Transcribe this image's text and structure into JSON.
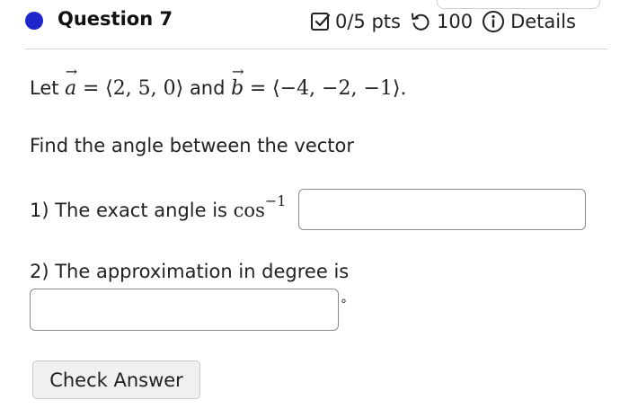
{
  "header": {
    "question_title": "Question 7",
    "points": "0/5 pts",
    "attempts": "100",
    "details_label": "Details",
    "icons": [
      "checkbox-icon",
      "retry-icon",
      "info-icon"
    ],
    "bullet_color": "#1f26c9"
  },
  "problem": {
    "let_label": "Let",
    "and_label": "and",
    "vector_a": {
      "name": "a",
      "components": "⟨2, 5, 0⟩"
    },
    "vector_b": {
      "name": "b",
      "components": "⟨−4, −2, −1⟩"
    },
    "equals": "=",
    "period": ".",
    "instruction": "Find the angle between the vector"
  },
  "part1": {
    "label": "1) The exact angle is",
    "function": "cos",
    "exponent": "−1",
    "input_value": ""
  },
  "part2": {
    "label": "2) The approximation in degree is",
    "input_value": "",
    "unit": "°"
  },
  "actions": {
    "check_answer_label": "Check Answer"
  }
}
